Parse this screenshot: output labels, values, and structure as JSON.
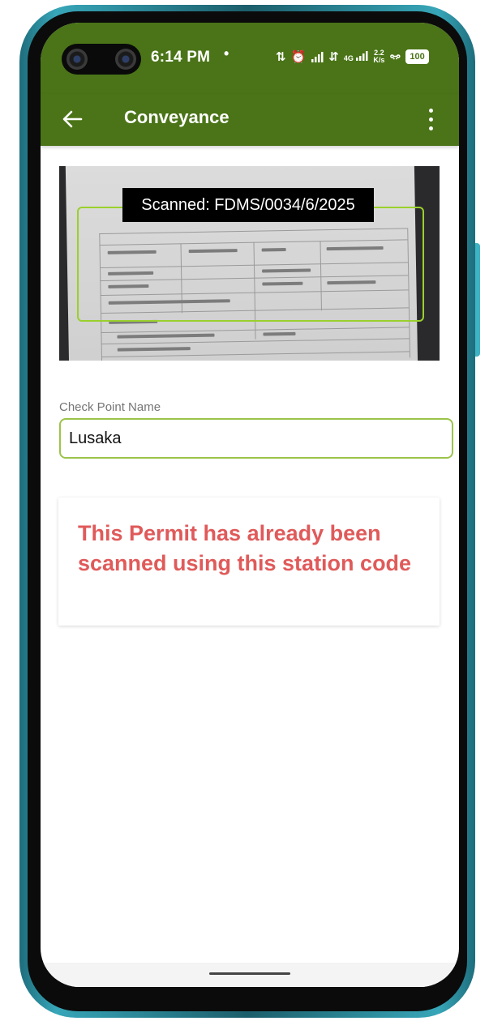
{
  "status_bar": {
    "time": "6:14 PM",
    "dot": "•",
    "icons": [
      "sync-icon",
      "alarm-icon",
      "signal-icon",
      "data-arrows-icon",
      "4g-signal-icon",
      "speed-icon",
      "vibrate-icon",
      "battery-icon"
    ],
    "network_speed_value": "2.2",
    "network_speed_unit": "K/s",
    "net_type": "4G",
    "battery_level": "100"
  },
  "app_bar": {
    "title": "Conveyance",
    "back_icon": "arrow-left-icon",
    "menu_icon": "more-vert-icon"
  },
  "scanner": {
    "label": "Scanned: FDMS/0034/6/2025",
    "frame_color": "#9ad02c"
  },
  "form": {
    "checkpoint_label": "Check Point Name",
    "checkpoint_value": "Lusaka"
  },
  "message": {
    "text": "This Permit has already been scanned using this station code",
    "color": "#e05a5a"
  },
  "colors": {
    "primary": "#4a7417",
    "accent": "#9bc44a",
    "error": "#e05a5a"
  }
}
